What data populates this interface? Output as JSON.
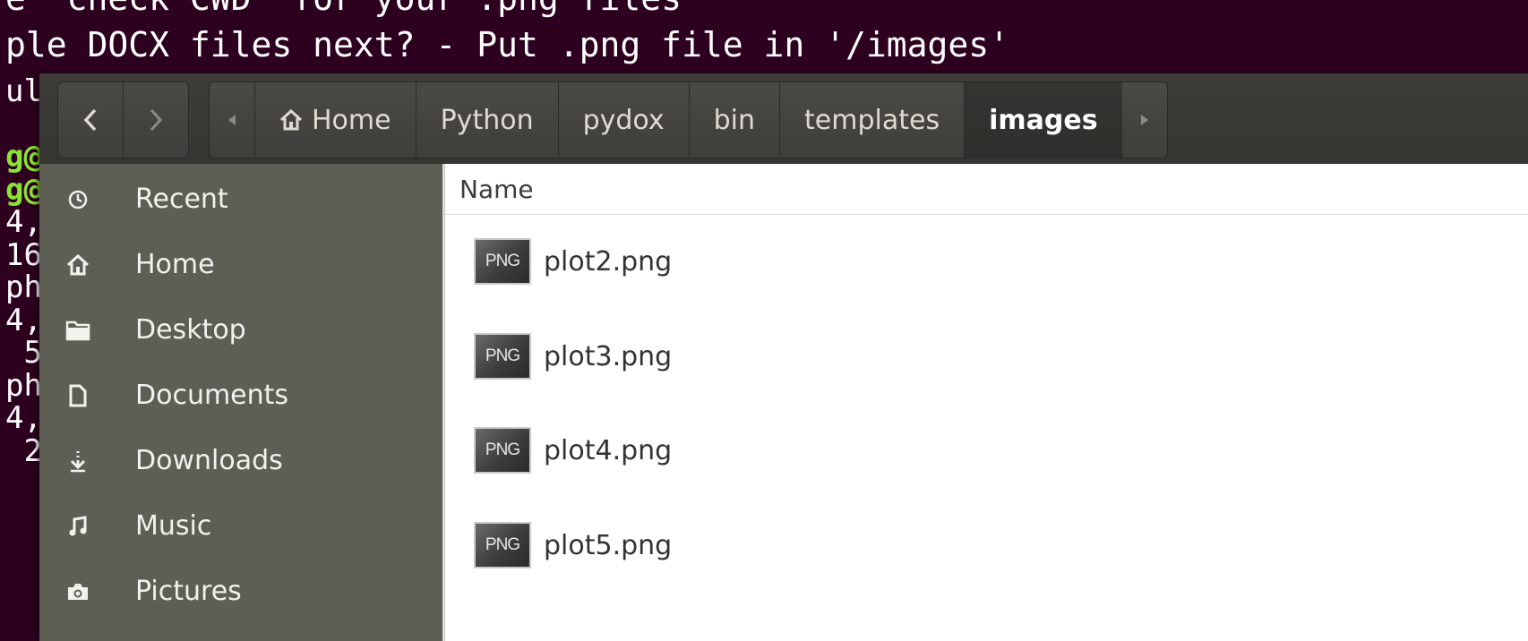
{
  "terminal": {
    "line_top": "e  check CWD  for your .png files",
    "line_second": "ple DOCX files next? - Put .png file in '/images'",
    "left_fragments": [
      "ul",
      "",
      "g@",
      "g@",
      "4,",
      "16",
      "ph",
      "4,",
      " 5",
      "ph",
      "4,",
      " 2"
    ]
  },
  "toolbar": {
    "back_glyph": "‹",
    "forward_glyph": "›",
    "path_left_arrow": "◂",
    "path_right_arrow": "▸",
    "crumbs": [
      "Home",
      "Python",
      "pydox",
      "bin",
      "templates",
      "images"
    ],
    "home_icon": "home-icon"
  },
  "sidebar": {
    "items": [
      {
        "label": "Recent",
        "icon": "clock-icon"
      },
      {
        "label": "Home",
        "icon": "home-icon"
      },
      {
        "label": "Desktop",
        "icon": "folder-icon"
      },
      {
        "label": "Documents",
        "icon": "document-icon"
      },
      {
        "label": "Downloads",
        "icon": "download-icon"
      },
      {
        "label": "Music",
        "icon": "music-icon"
      },
      {
        "label": "Pictures",
        "icon": "camera-icon"
      }
    ]
  },
  "main": {
    "column_name": "Name",
    "thumb_label": "PNG",
    "files": [
      "plot2.png",
      "plot3.png",
      "plot4.png",
      "plot5.png"
    ]
  }
}
